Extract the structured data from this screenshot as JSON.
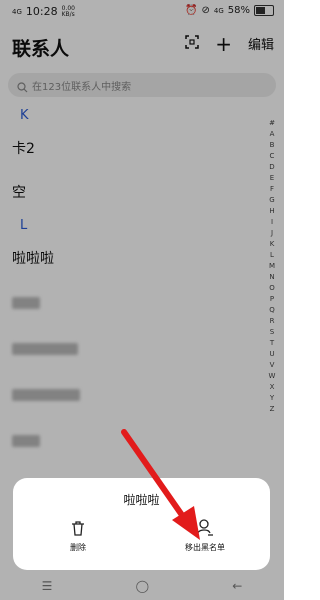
{
  "status_bar": {
    "signal": "4G",
    "time": "10:28",
    "net_speed": "0.00 KB/s",
    "right_signal": "4G",
    "battery": "58%",
    "battery_level": 0.58
  },
  "header": {
    "title": "联系人",
    "edit_label": "编辑"
  },
  "search": {
    "placeholder": "在123位联系人中搜索"
  },
  "contacts": {
    "section_k": "K",
    "item_1": "卡2",
    "item_2": "空",
    "section_l": "L",
    "item_3": "啦啦啦"
  },
  "alphabet": [
    "#",
    "A",
    "B",
    "C",
    "D",
    "E",
    "F",
    "G",
    "H",
    "I",
    "J",
    "K",
    "L",
    "M",
    "N",
    "O",
    "P",
    "Q",
    "R",
    "S",
    "T",
    "U",
    "V",
    "W",
    "X",
    "Y",
    "Z"
  ],
  "sheet": {
    "title": "啦啦啦",
    "delete_label": "删除",
    "unblock_label": "移出黑名单"
  }
}
